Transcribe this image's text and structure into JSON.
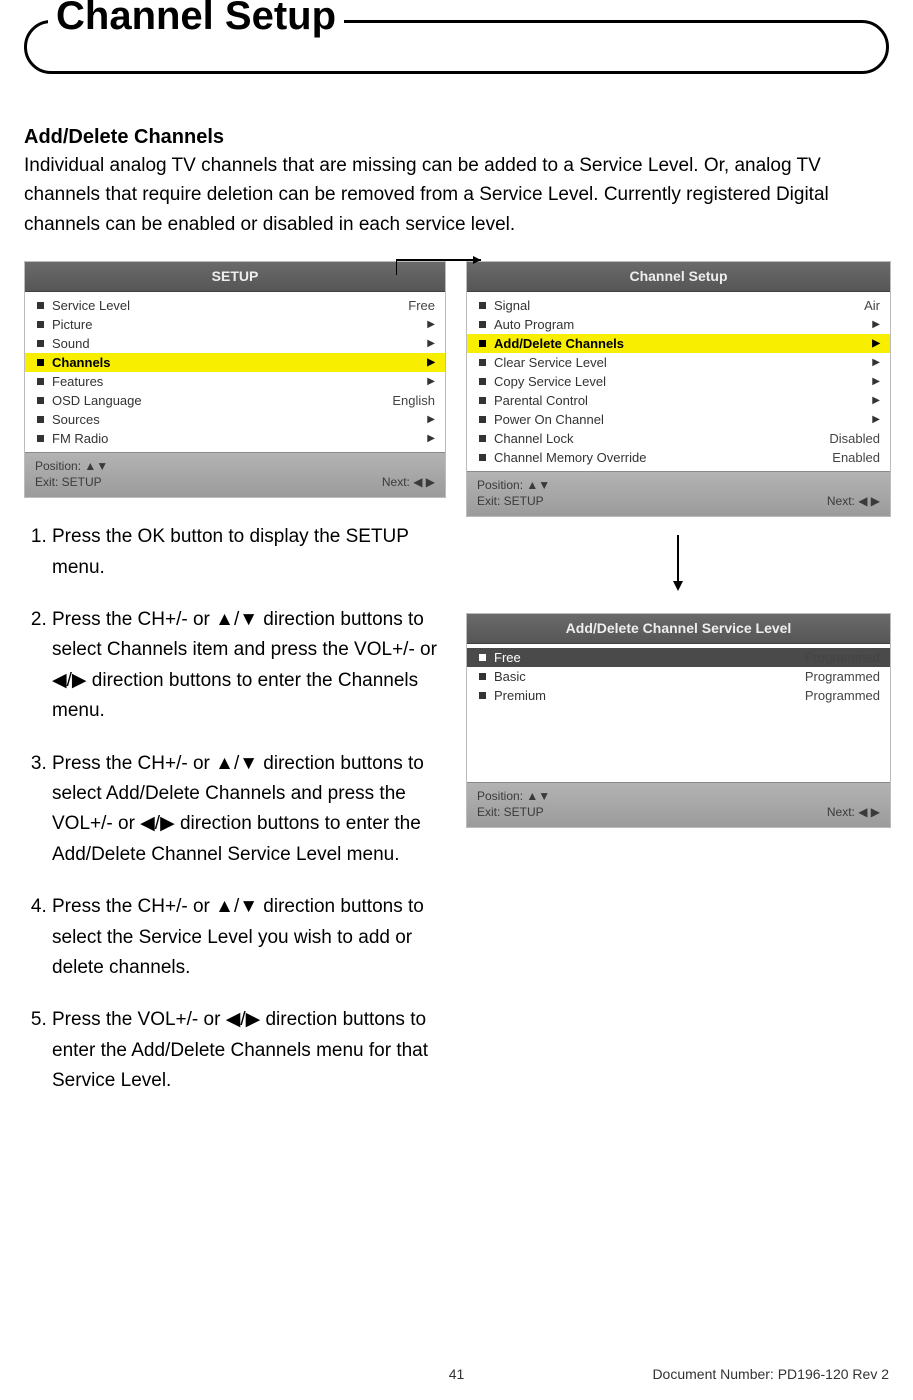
{
  "section_title": "Channel Setup",
  "subhead": "Add/Delete Channels",
  "intro": "Individual analog TV channels that are missing can be added to a Service Level. Or, analog TV channels that require deletion can be removed from a Service Level. Currently registered Digital channels can be enabled or disabled in each service level.",
  "panel_setup": {
    "title": "SETUP",
    "items": [
      {
        "label": "Service Level",
        "value": "Free",
        "caret": false
      },
      {
        "label": "Picture",
        "value": "",
        "caret": true
      },
      {
        "label": "Sound",
        "value": "",
        "caret": true
      },
      {
        "label": "Channels",
        "value": "",
        "caret": true,
        "highlight": true
      },
      {
        "label": "Features",
        "value": "",
        "caret": true
      },
      {
        "label": "OSD Language",
        "value": "English",
        "caret": false
      },
      {
        "label": "Sources",
        "value": "",
        "caret": true
      },
      {
        "label": "FM Radio",
        "value": "",
        "caret": true
      }
    ],
    "footer": {
      "pos": "Position: ▲▼",
      "exit": "Exit: SETUP",
      "next": "Next: ◀ ▶"
    }
  },
  "panel_channel": {
    "title": "Channel Setup",
    "items": [
      {
        "label": "Signal",
        "value": "Air",
        "caret": false
      },
      {
        "label": "Auto Program",
        "value": "",
        "caret": true
      },
      {
        "label": "Add/Delete Channels",
        "value": "",
        "caret": true,
        "highlight": true
      },
      {
        "label": "Clear Service Level",
        "value": "",
        "caret": true
      },
      {
        "label": "Copy Service Level",
        "value": "",
        "caret": true
      },
      {
        "label": "Parental Control",
        "value": "",
        "caret": true
      },
      {
        "label": "Power On Channel",
        "value": "",
        "caret": true
      },
      {
        "label": "Channel Lock",
        "value": "Disabled",
        "caret": false
      },
      {
        "label": "Channel Memory Override",
        "value": "Enabled",
        "caret": false
      }
    ],
    "footer": {
      "pos": "Position: ▲▼",
      "exit": "Exit: SETUP",
      "next": "Next: ◀ ▶"
    }
  },
  "panel_service": {
    "title": "Add/Delete Channel Service Level",
    "items": [
      {
        "label": "Free",
        "value": "Programmed",
        "sel": true
      },
      {
        "label": "Basic",
        "value": "Programmed"
      },
      {
        "label": "Premium",
        "value": "Programmed"
      }
    ],
    "footer": {
      "pos": "Position: ▲▼",
      "exit": "Exit: SETUP",
      "next": "Next: ◀ ▶"
    }
  },
  "steps": [
    "Press the OK button to display the SETUP menu.",
    "Press the CH+/- or ▲/▼ direction buttons to select Channels item and press the VOL+/- or ◀/▶ direction buttons to enter the Channels menu.",
    "Press the CH+/- or ▲/▼ direction buttons to select Add/Delete Channels and press the VOL+/- or ◀/▶ direction buttons to enter the Add/Delete Channel Service Level menu.",
    "Press the CH+/- or ▲/▼ direction buttons to select the Service Level you wish to add or delete channels.",
    "Press the VOL+/- or ◀/▶ direction buttons to enter the Add/Delete Channels menu for that Service Level."
  ],
  "footer": {
    "page": "41",
    "doc": "Document Number: PD196-120 Rev 2"
  }
}
